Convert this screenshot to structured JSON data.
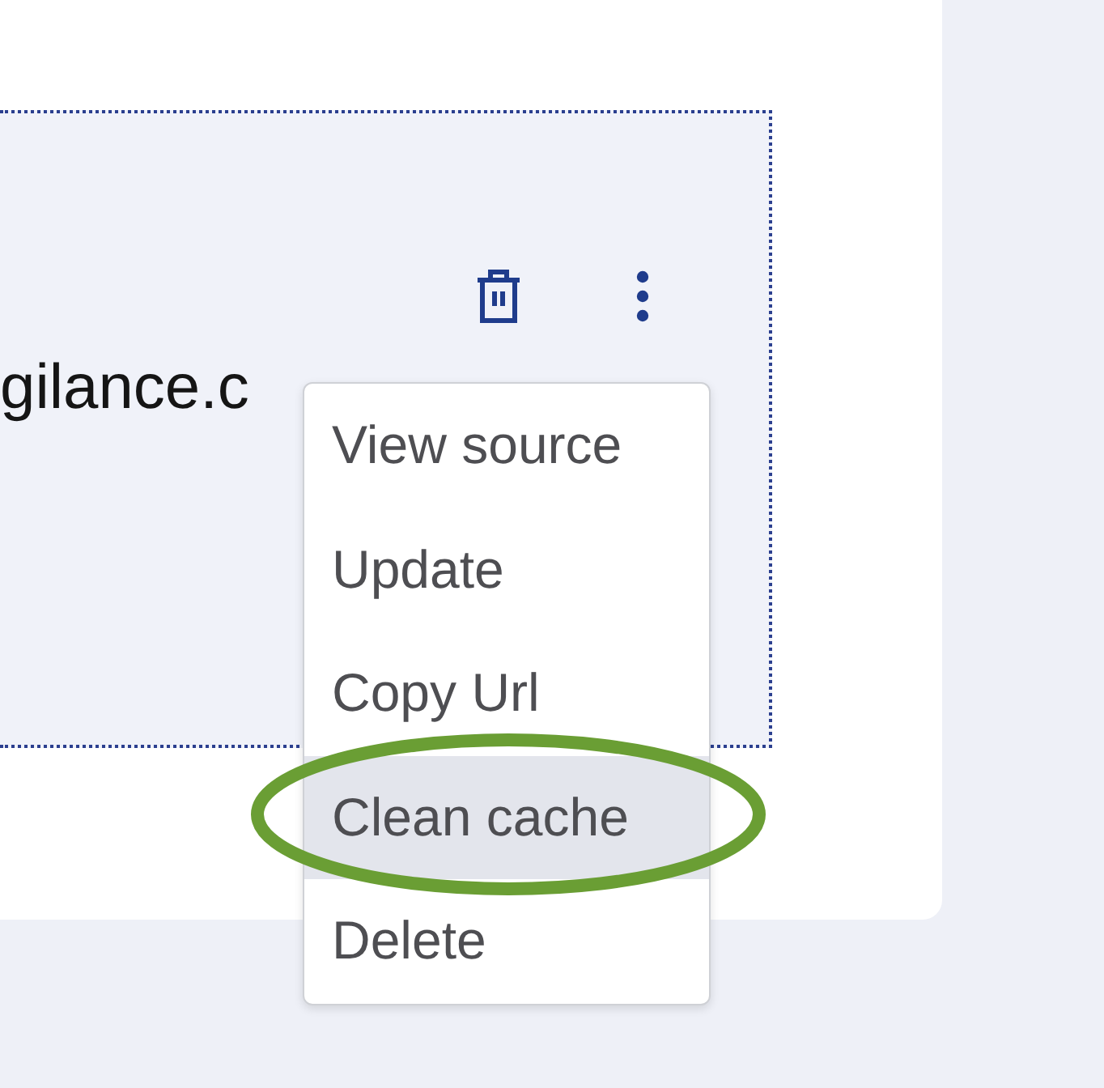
{
  "file": {
    "name": "gilance.c"
  },
  "menu": {
    "items": [
      {
        "label": "View source",
        "selected": false
      },
      {
        "label": "Update",
        "selected": false
      },
      {
        "label": "Copy Url",
        "selected": false
      },
      {
        "label": "Clean cache",
        "selected": true
      },
      {
        "label": "Delete",
        "selected": false
      }
    ]
  }
}
